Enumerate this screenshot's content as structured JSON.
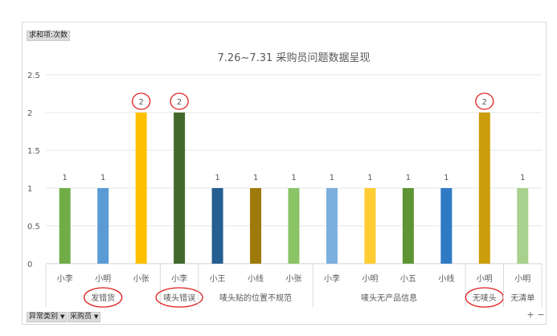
{
  "chart_data": {
    "type": "bar",
    "title": "7.26~7.31 采购员问题数据呈现",
    "ylim": [
      0,
      2.5
    ],
    "yticks": [
      "0",
      "0.5",
      "1",
      "1.5",
      "2",
      "2.5"
    ],
    "grid": true,
    "groups": [
      {
        "name": "发错货",
        "circled": true,
        "items": [
          {
            "label": "小李",
            "value": 1,
            "color": "#70ad47"
          },
          {
            "label": "小明",
            "value": 1,
            "color": "#5b9bd5"
          },
          {
            "label": "小张",
            "value": 2,
            "color": "#ffc000",
            "circled": true
          }
        ]
      },
      {
        "name": "唛头错误",
        "circled": true,
        "items": [
          {
            "label": "小李",
            "value": 2,
            "color": "#43682b",
            "circled": true
          }
        ]
      },
      {
        "name": "唛头贴的位置不规范",
        "circled": false,
        "items": [
          {
            "label": "小王",
            "value": 1,
            "color": "#255e91"
          },
          {
            "label": "小线",
            "value": 1,
            "color": "#9e7a0a"
          },
          {
            "label": "小张",
            "value": 1,
            "color": "#8bc467"
          }
        ]
      },
      {
        "name": "唛头无产品信息",
        "circled": false,
        "items": [
          {
            "label": "小李",
            "value": 1,
            "color": "#7cafdd"
          },
          {
            "label": "小明",
            "value": 1,
            "color": "#ffcd33"
          },
          {
            "label": "小五",
            "value": 1,
            "color": "#5e9434"
          },
          {
            "label": "小线",
            "value": 1,
            "color": "#2e7bc4"
          }
        ]
      },
      {
        "name": "无唛头",
        "circled": true,
        "items": [
          {
            "label": "小明",
            "value": 2,
            "color": "#cc9d0a",
            "circled": true
          }
        ]
      },
      {
        "name": "无清单",
        "circled": false,
        "items": [
          {
            "label": "小明",
            "value": 1,
            "color": "#a9d18e"
          }
        ]
      }
    ]
  },
  "pivot": {
    "value_field": "求和项:次数",
    "category_field": "异常类别",
    "buyer_field": "采购员",
    "dropdown_glyph": "▼",
    "zoom_in": "+",
    "zoom_out": "−"
  },
  "colors": {
    "annotation": "#e02020",
    "grid": "#e6e6e6",
    "text": "#595959"
  }
}
